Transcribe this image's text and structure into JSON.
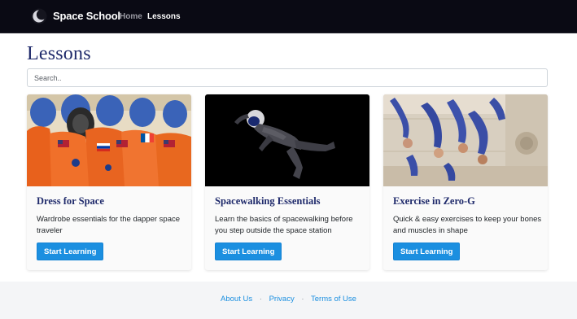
{
  "navbar": {
    "brand": "Space School",
    "links": [
      {
        "label": "Home",
        "active": false
      },
      {
        "label": "Lessons",
        "active": true
      }
    ]
  },
  "page": {
    "title": "Lessons"
  },
  "search": {
    "placeholder": "Search..",
    "value": ""
  },
  "cards": [
    {
      "title": "Dress for Space",
      "text": "Wardrobe essentials for the dapper space traveler",
      "button": "Start Learning",
      "image_icon": "orange-spacesuits-photo"
    },
    {
      "title": "Spacewalking Essentials",
      "text": "Learn the basics of spacewalking before you step outside the space station",
      "button": "Start Learning",
      "image_icon": "astronaut-floating-photo"
    },
    {
      "title": "Exercise in Zero-G",
      "text": "Quick & easy exercises to keep your bones and muscles in shape",
      "button": "Start Learning",
      "image_icon": "zero-gravity-crew-photo"
    }
  ],
  "footer": {
    "links": [
      "About Us",
      "Privacy",
      "Terms of Use"
    ],
    "separator": "·"
  },
  "colors": {
    "navbar_bg": "#0a0a14",
    "title": "#1f2a6b",
    "accent": "#1b8fe0",
    "footer_bg": "#f4f5f7"
  }
}
